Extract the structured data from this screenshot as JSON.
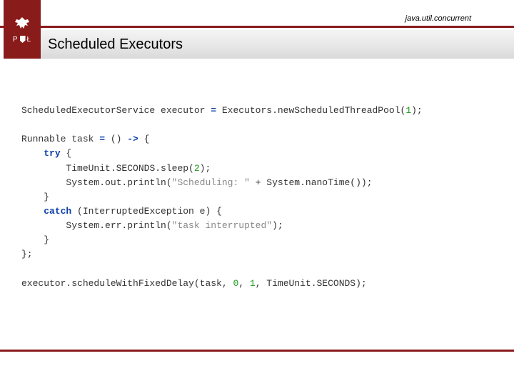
{
  "header": {
    "package": "java.util.concurrent",
    "logo_letters_left": "P",
    "logo_letters_right": "Ł",
    "title": "Scheduled Executors"
  },
  "code": {
    "l1_a": "ScheduledExecutorService executor ",
    "l1_eq": "=",
    "l1_b": " Executors.newScheduledThreadPool(",
    "l1_n": "1",
    "l1_c": ");",
    "l2_a": "Runnable task ",
    "l2_eq": "=",
    "l2_b": " () ",
    "l2_arrow": "->",
    "l2_c": " {",
    "l3_indent": "    ",
    "l3_kw": "try",
    "l3_b": " {",
    "l4_indent": "        ",
    "l4_a": "TimeUnit.SECONDS.sleep(",
    "l4_n": "2",
    "l4_b": ");",
    "l5_indent": "        ",
    "l5_a": "System.out.println(",
    "l5_s": "\"Scheduling: \"",
    "l5_b": " + System.nanoTime());",
    "l6_indent": "    ",
    "l6_a": "}",
    "l7_indent": "    ",
    "l7_kw": "catch",
    "l7_b": " (InterruptedException e) {",
    "l8_indent": "        ",
    "l8_a": "System.err.println(",
    "l8_s": "\"task interrupted\"",
    "l8_b": ");",
    "l9_indent": "    ",
    "l9_a": "}",
    "l10_a": "};",
    "l11_a": "executor.scheduleWithFixedDelay(task, ",
    "l11_n1": "0",
    "l11_b": ", ",
    "l11_n2": "1",
    "l11_c": ", TimeUnit.SECONDS);"
  }
}
